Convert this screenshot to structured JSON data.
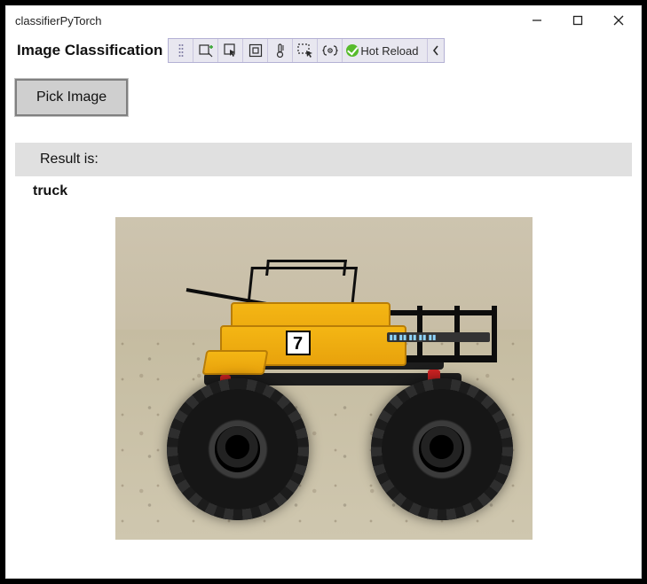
{
  "window": {
    "title": "classifierPyTorch"
  },
  "header": {
    "heading": "Image Classification"
  },
  "toolbar": {
    "items": [
      {
        "name": "add-view-icon"
      },
      {
        "name": "inspect-cursor-icon"
      },
      {
        "name": "frame-icon"
      },
      {
        "name": "thermometer-icon"
      },
      {
        "name": "select-region-icon"
      },
      {
        "name": "braces-target-icon"
      }
    ],
    "hot_reload_label": "Hot Reload"
  },
  "actions": {
    "pick_image_label": "Pick Image"
  },
  "result": {
    "label": "Result is:",
    "value": "truck"
  },
  "image": {
    "subject": "yellow-monster-truck-model",
    "number_plate": "7"
  }
}
